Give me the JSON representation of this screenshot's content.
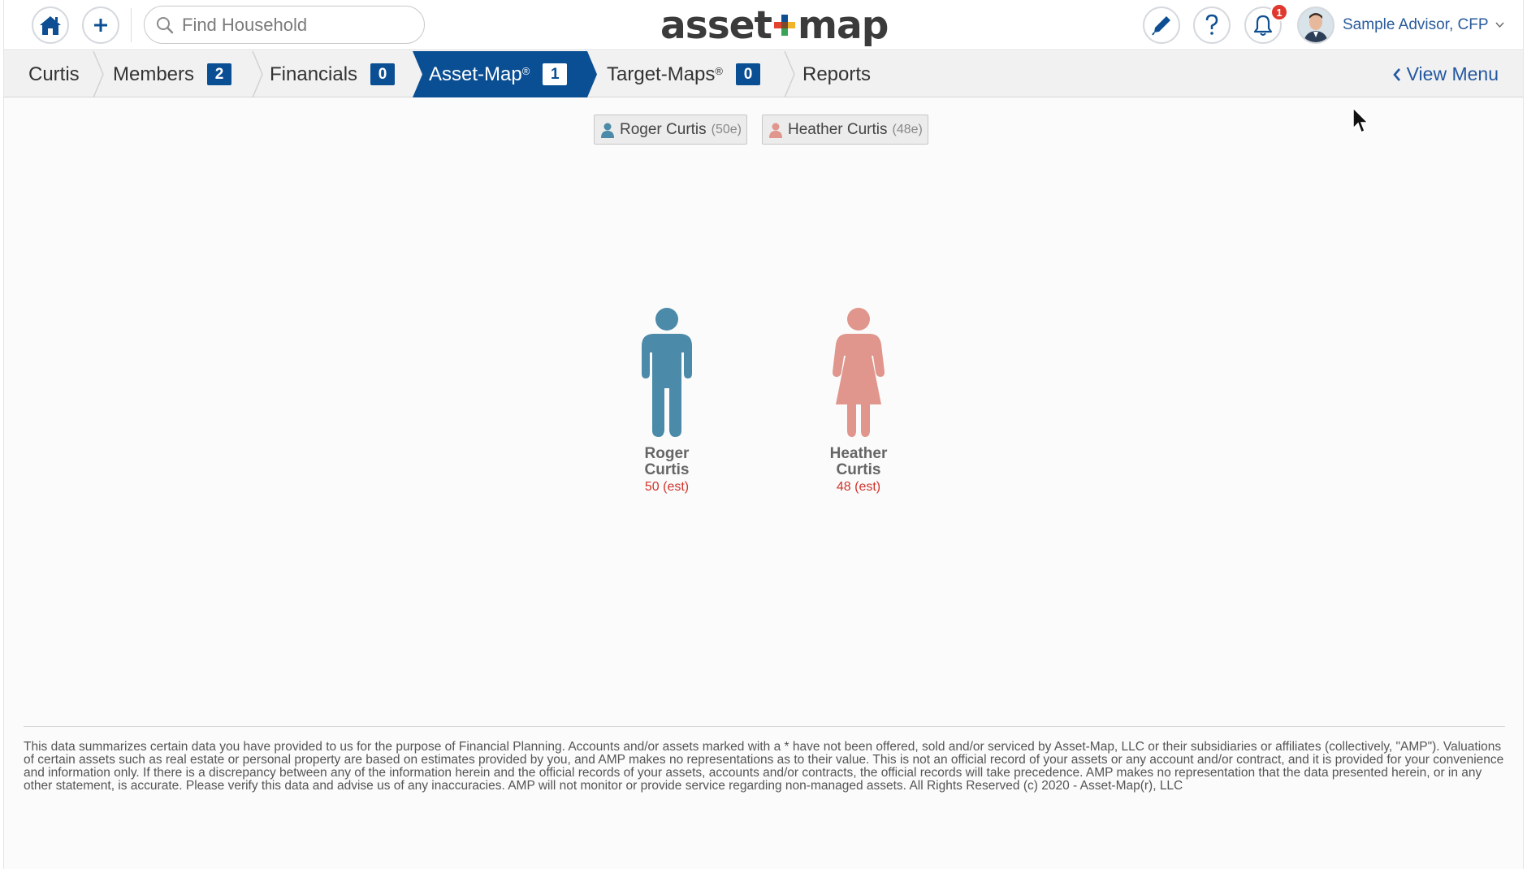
{
  "header": {
    "search": {
      "placeholder": "Find Household"
    },
    "logo": {
      "left": "asset",
      "right": "map"
    },
    "notifications": {
      "count": "1"
    },
    "advisor": {
      "name": "Sample Advisor, CFP"
    }
  },
  "nav": {
    "crumbs": [
      {
        "label": "Curtis"
      },
      {
        "label": "Members",
        "count": "2"
      },
      {
        "label": "Financials",
        "count": "0"
      },
      {
        "label": "Asset-Map",
        "sup": "®",
        "count": "1"
      },
      {
        "label": "Target-Maps",
        "sup": "®",
        "count": "0"
      },
      {
        "label": "Reports"
      }
    ],
    "view_menu": "View Menu"
  },
  "members": [
    {
      "name": "Roger Curtis",
      "est": "(50e)",
      "first": "Roger",
      "last": "Curtis",
      "age": "50 (est)",
      "color": "#4b8aa8"
    },
    {
      "name": "Heather Curtis",
      "est": "(48e)",
      "first": "Heather",
      "last": "Curtis",
      "age": "48 (est)",
      "color": "#e0968c"
    }
  ],
  "footer": {
    "disclaimer": "This data summarizes certain data you have provided to us for the purpose of Financial Planning. Accounts and/or assets marked with a * have not been offered, sold and/or serviced by Asset-Map, LLC or their subsidiaries or affiliates (collectively, \"AMP\"). Valuations of certain assets such as real estate or personal property are based on estimates provided by you, and AMP makes no representations as to their value. This is not an official record of your assets or any account and/or contract, and it is provided for your convenience and information only. If there is a discrepancy between any of the information herein and the official records of your assets, accounts and/or contracts, the official records will take precedence. AMP makes no representation that the data presented herein, or in any other statement, is accurate. Please verify this data and advise us of any inaccuracies. AMP will not monitor or provide service regarding non-managed assets. All Rights Reserved (c) 2020 - Asset-Map(r), LLC"
  }
}
